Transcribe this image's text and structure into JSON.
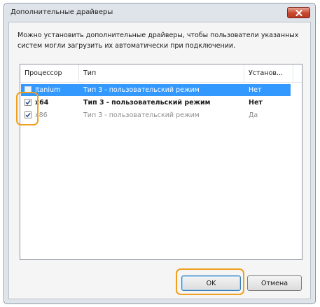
{
  "window": {
    "title": "Дополнительные драйверы"
  },
  "description": "Можно установить дополнительные драйверы, чтобы пользователи указанных систем могли загрузить их автоматически при подключении.",
  "table": {
    "columns": [
      "Процессор",
      "Тип",
      "Установ..."
    ],
    "rows": [
      {
        "processor": "Itanium",
        "type": "Тип 3 - пользовательский режим",
        "installed": "Нет",
        "checked": false,
        "selected": true,
        "style": "selected"
      },
      {
        "processor": "x64",
        "type": "Тип 3 - пользовательский режим",
        "installed": "Нет",
        "checked": true,
        "selected": false,
        "style": "bold"
      },
      {
        "processor": "x86",
        "type": "Тип 3 - пользовательский режим",
        "installed": "Да",
        "checked": true,
        "selected": false,
        "style": "dim"
      }
    ]
  },
  "buttons": {
    "ok": "OK",
    "cancel": "Отмена"
  },
  "colors": {
    "selection": "#3399ff",
    "highlight": "#f0a01e",
    "close_button": "#c9482f"
  }
}
